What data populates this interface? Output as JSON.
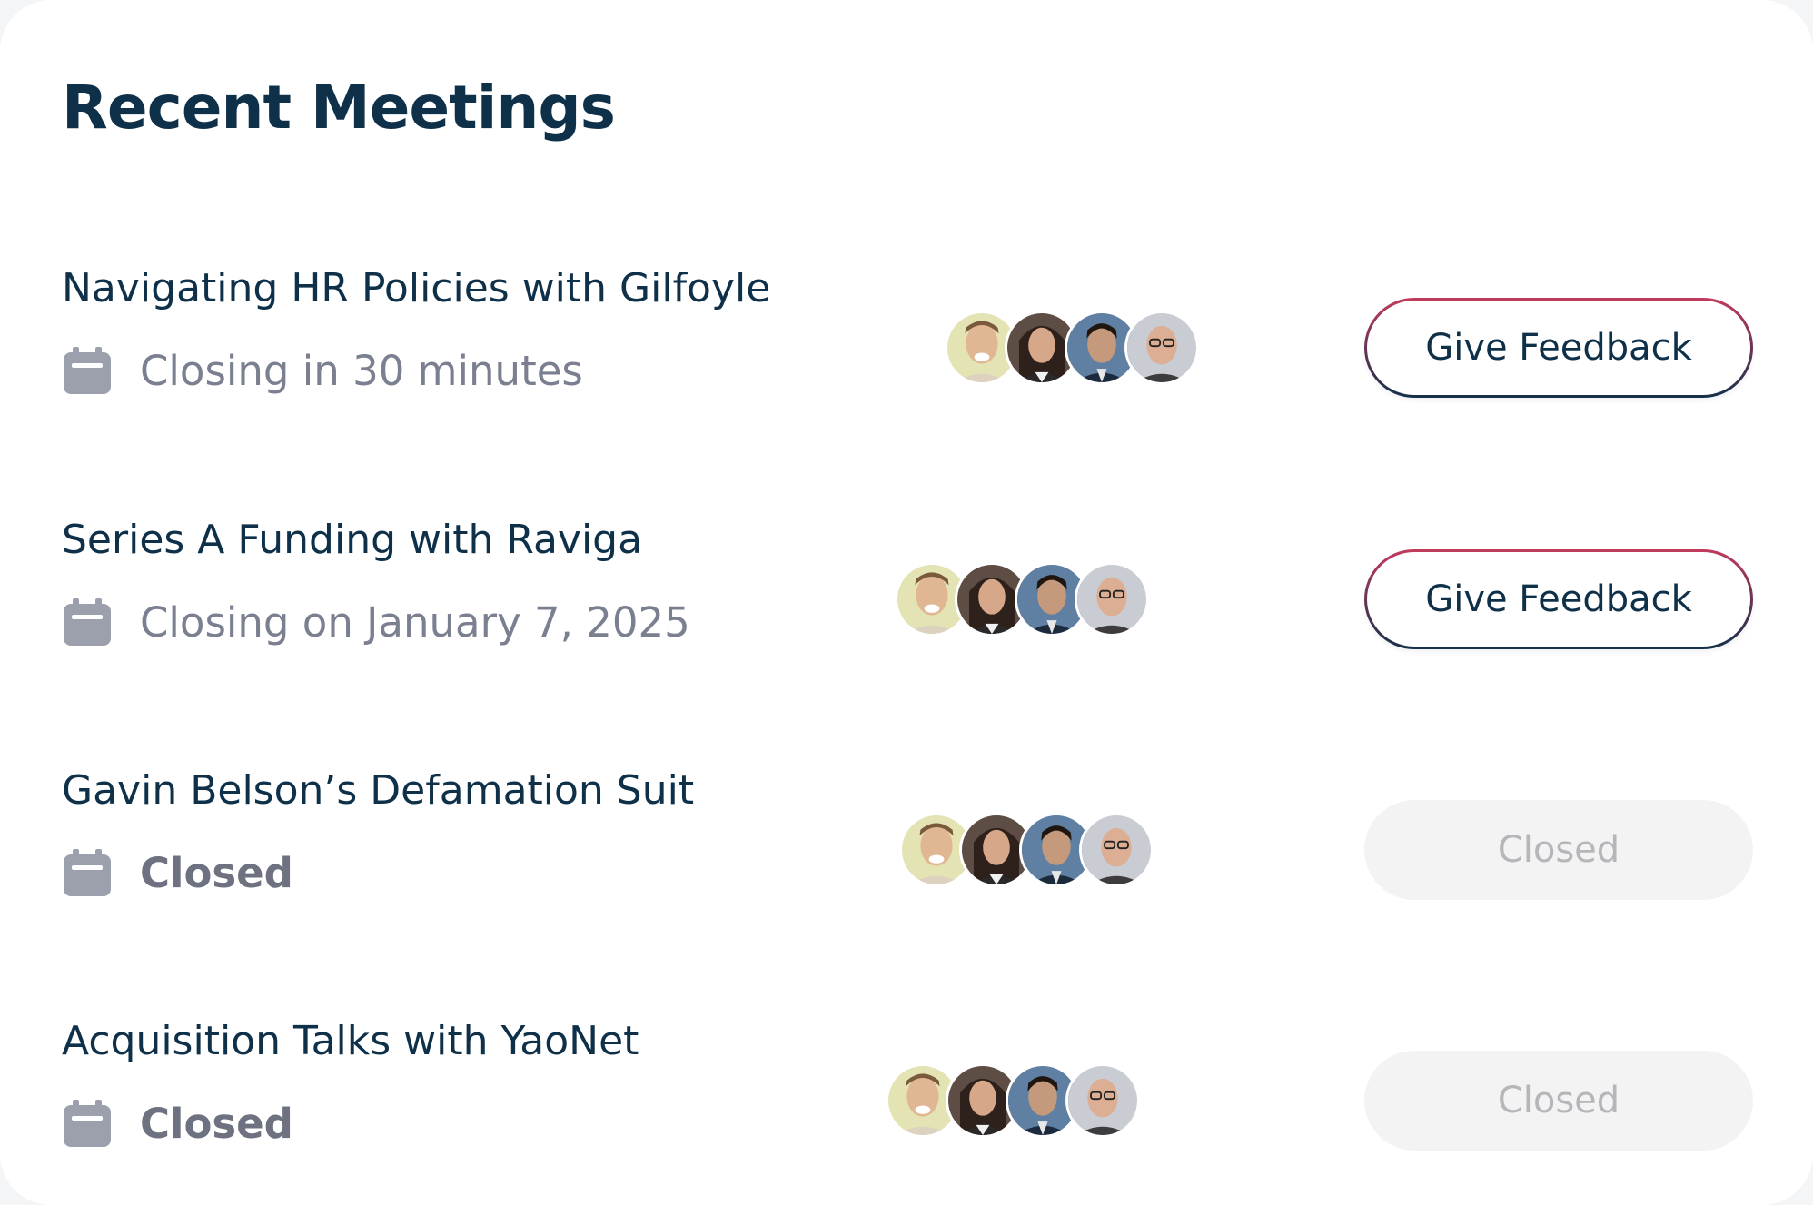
{
  "page": {
    "title": "Recent Meetings"
  },
  "colors": {
    "title": "#0f3049",
    "status_grey": "#7b8091",
    "button_border_top": "#c23a5c",
    "button_border_bottom": "#15314a",
    "closed_button_bg": "#f3f3f4",
    "closed_button_text": "#b5b6ba"
  },
  "icons": {
    "status": "calendar-icon"
  },
  "meetings": [
    {
      "name": "Navigating HR Policies with Gilfoyle",
      "status": "Closing in 30 minutes",
      "status_closed": false,
      "action_label": "Give Feedback",
      "action_enabled": true,
      "participants": [
        "participant-1",
        "participant-2",
        "participant-3",
        "participant-4"
      ]
    },
    {
      "name": "Series A Funding with Raviga",
      "status": "Closing on January 7, 2025",
      "status_closed": false,
      "action_label": "Give Feedback",
      "action_enabled": true,
      "participants": [
        "participant-1",
        "participant-2",
        "participant-3",
        "participant-4"
      ]
    },
    {
      "name": "Gavin Belson’s Defamation Suit",
      "status": "Closed",
      "status_closed": true,
      "action_label": "Closed",
      "action_enabled": false,
      "participants": [
        "participant-1",
        "participant-2",
        "participant-3",
        "participant-4"
      ]
    },
    {
      "name": "Acquisition Talks with YaoNet",
      "status": "Closed",
      "status_closed": true,
      "action_label": "Closed",
      "action_enabled": false,
      "participants": [
        "participant-1",
        "participant-2",
        "participant-3",
        "participant-4"
      ]
    }
  ]
}
